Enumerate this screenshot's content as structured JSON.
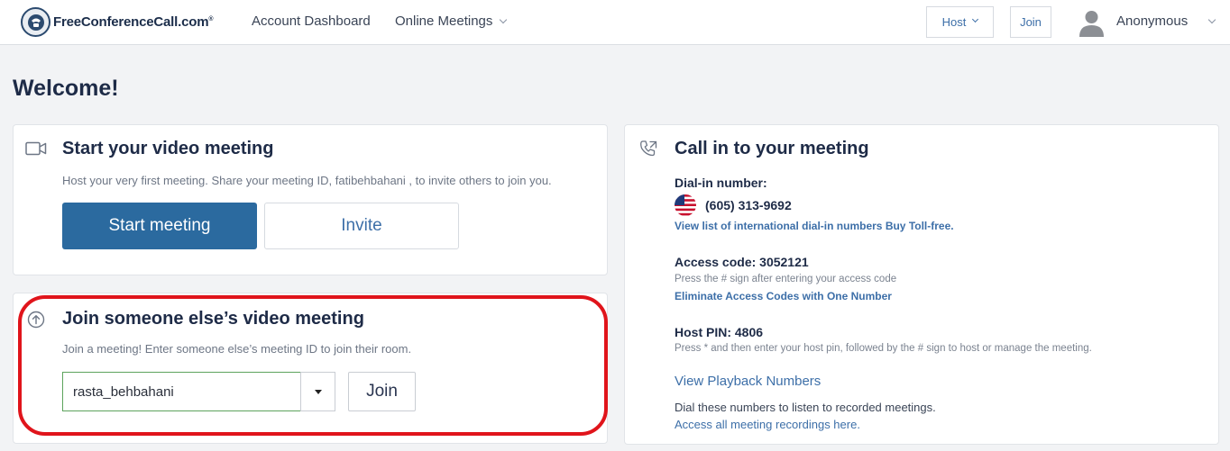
{
  "header": {
    "logo_text": "FreeConferenceCall.com",
    "logo_reg": "®",
    "nav": {
      "account_dashboard": "Account Dashboard",
      "online_meetings": "Online Meetings"
    },
    "host_label": "Host",
    "join_label": "Join",
    "user_name": "Anonymous"
  },
  "page_title": "Welcome!",
  "start_card": {
    "title": "Start your video meeting",
    "description": "Host your very first meeting. Share your meeting ID, fatibehbahani , to invite others to join you.",
    "start_button": "Start meeting",
    "invite_button": "Invite"
  },
  "join_card": {
    "title": "Join someone else’s video meeting",
    "description": "Join a meeting! Enter someone else’s meeting ID to join their room.",
    "input_value": "rasta_behbahani",
    "join_button": "Join"
  },
  "call_card": {
    "title": "Call in to your meeting",
    "dial_in_label": "Dial-in number:",
    "dial_in_number": "(605) 313-9692",
    "international_link": "View list of international dial-in numbers Buy Toll-free.",
    "access_code_label": "Access code: 3052121",
    "access_code_hint": "Press the # sign after entering your access code",
    "eliminate_link": "Eliminate Access Codes with One Number",
    "host_pin_label": "Host PIN: 4806",
    "host_pin_hint": "Press * and then enter your host pin, followed by the # sign to host or manage the meeting.",
    "playback_link": "View Playback Numbers",
    "playback_text": "Dial these numbers to listen to recorded meetings.",
    "recordings_link": "Access all meeting recordings here."
  },
  "colors": {
    "primary_button": "#2b6a9f",
    "link": "#3d6fa8",
    "highlight": "#e0141b"
  }
}
